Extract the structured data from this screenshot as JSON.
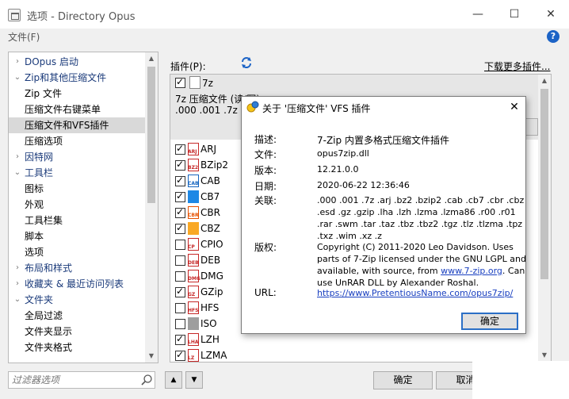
{
  "window": {
    "title": "选项 - Directory Opus",
    "minimize": "—",
    "maximize": "☐",
    "close": "✕"
  },
  "menu": {
    "file": "文件(F)",
    "help": "?"
  },
  "tree": {
    "items": [
      {
        "label": "DOpus 启动",
        "level": 0,
        "expander": "›"
      },
      {
        "label": "Zip和其他压缩文件",
        "level": 0,
        "expander": "⌄"
      },
      {
        "label": "Zip 文件",
        "level": 1
      },
      {
        "label": "压缩文件右键菜单",
        "level": 1
      },
      {
        "label": "压缩文件和VFS插件",
        "level": 1,
        "selected": true
      },
      {
        "label": "压缩选项",
        "level": 1
      },
      {
        "label": "因特网",
        "level": 0,
        "expander": "›"
      },
      {
        "label": "工具栏",
        "level": 0,
        "expander": "⌄"
      },
      {
        "label": "图标",
        "level": 1
      },
      {
        "label": "外观",
        "level": 1
      },
      {
        "label": "工具栏集",
        "level": 1
      },
      {
        "label": "脚本",
        "level": 1
      },
      {
        "label": "选项",
        "level": 1
      },
      {
        "label": "布局和样式",
        "level": 0,
        "expander": "›"
      },
      {
        "label": "收藏夹 & 最近访问列表",
        "level": 0,
        "expander": "›"
      },
      {
        "label": "文件夹",
        "level": 0,
        "expander": "⌄"
      },
      {
        "label": "全局过滤",
        "level": 1
      },
      {
        "label": "文件夹显示",
        "level": 1
      },
      {
        "label": "文件夹格式",
        "level": 1
      }
    ],
    "filter_placeholder": "过滤器选项"
  },
  "plugins": {
    "label": "插件(P):",
    "more_link": "下载更多插件...",
    "selected": {
      "name": "7z",
      "description": "7z 压缩文件 (读/写)",
      "extensions": ".000 .001 .7z"
    },
    "rows": [
      {
        "name": "ARJ",
        "checked": true,
        "tag": "ARJ",
        "color": "#c62828"
      },
      {
        "name": "BZip2",
        "checked": true,
        "tag": "BZ2",
        "color": "#c62828"
      },
      {
        "name": "CAB",
        "checked": true,
        "tag": "CAB",
        "color": "#1565c0"
      },
      {
        "name": "CB7",
        "checked": true,
        "tag": "",
        "color": "#1e88e5"
      },
      {
        "name": "CBR",
        "checked": true,
        "tag": "CBR",
        "color": "#e65100"
      },
      {
        "name": "CBZ",
        "checked": true,
        "tag": "",
        "color": "#f9a825"
      },
      {
        "name": "CPIO",
        "checked": false,
        "tag": "CP",
        "color": "#c62828"
      },
      {
        "name": "DEB",
        "checked": false,
        "tag": "DEB",
        "color": "#c62828"
      },
      {
        "name": "DMG",
        "checked": false,
        "tag": "DMG",
        "color": "#c62828"
      },
      {
        "name": "GZip",
        "checked": true,
        "tag": "GZ",
        "color": "#c62828"
      },
      {
        "name": "HFS",
        "checked": false,
        "tag": "HFS",
        "color": "#c62828"
      },
      {
        "name": "ISO",
        "checked": false,
        "tag": "",
        "color": "#9e9e9e"
      },
      {
        "name": "LZH",
        "checked": true,
        "tag": "LHA",
        "color": "#c62828"
      },
      {
        "name": "LZMA",
        "checked": true,
        "tag": "LZ",
        "color": "#c62828"
      }
    ]
  },
  "buttons": {
    "ok": "确定",
    "cancel": "取消",
    "up": "▲",
    "down": "▼"
  },
  "dialog": {
    "title": "关于 '压缩文件' VFS 插件",
    "close": "✕",
    "fields": {
      "desc_label": "描述:",
      "desc_value": "7-Zip 内置多格式压缩文件插件",
      "file_label": "文件:",
      "file_value": "opus7zip.dll",
      "version_label": "版本:",
      "version_value": "12.21.0.0",
      "date_label": "日期:",
      "date_value": "2020-06-22 12:36:46",
      "assoc_label": "关联:",
      "assoc_lines": [
        ".000 .001 .7z .arj .bz2 .bzip2 .cab .cb7 .cbr .cbz",
        ".esd .gz .gzip .lha .lzh .lzma .lzma86 .r00 .r01",
        ".rar .swm .tar .taz .tbz .tbz2 .tgz .tlz .tlzma .tpz",
        ".txz .wim .xz .z"
      ],
      "copyright_label": "版权:",
      "copyright_lines": [
        "Copyright (C) 2011-2020 Leo Davidson. Uses",
        "parts of 7-Zip licensed under the GNU LGPL and",
        "use UnRAR DLL by Alexander Roshal."
      ],
      "copyright_line3_pre": "available, with source, from ",
      "copyright_link": "www.7-zip.org",
      "copyright_line3_post": ". Can",
      "url_label": "URL:",
      "url_value": "https://www.PretentiousName.com/opus7zip/"
    },
    "ok": "确定"
  }
}
